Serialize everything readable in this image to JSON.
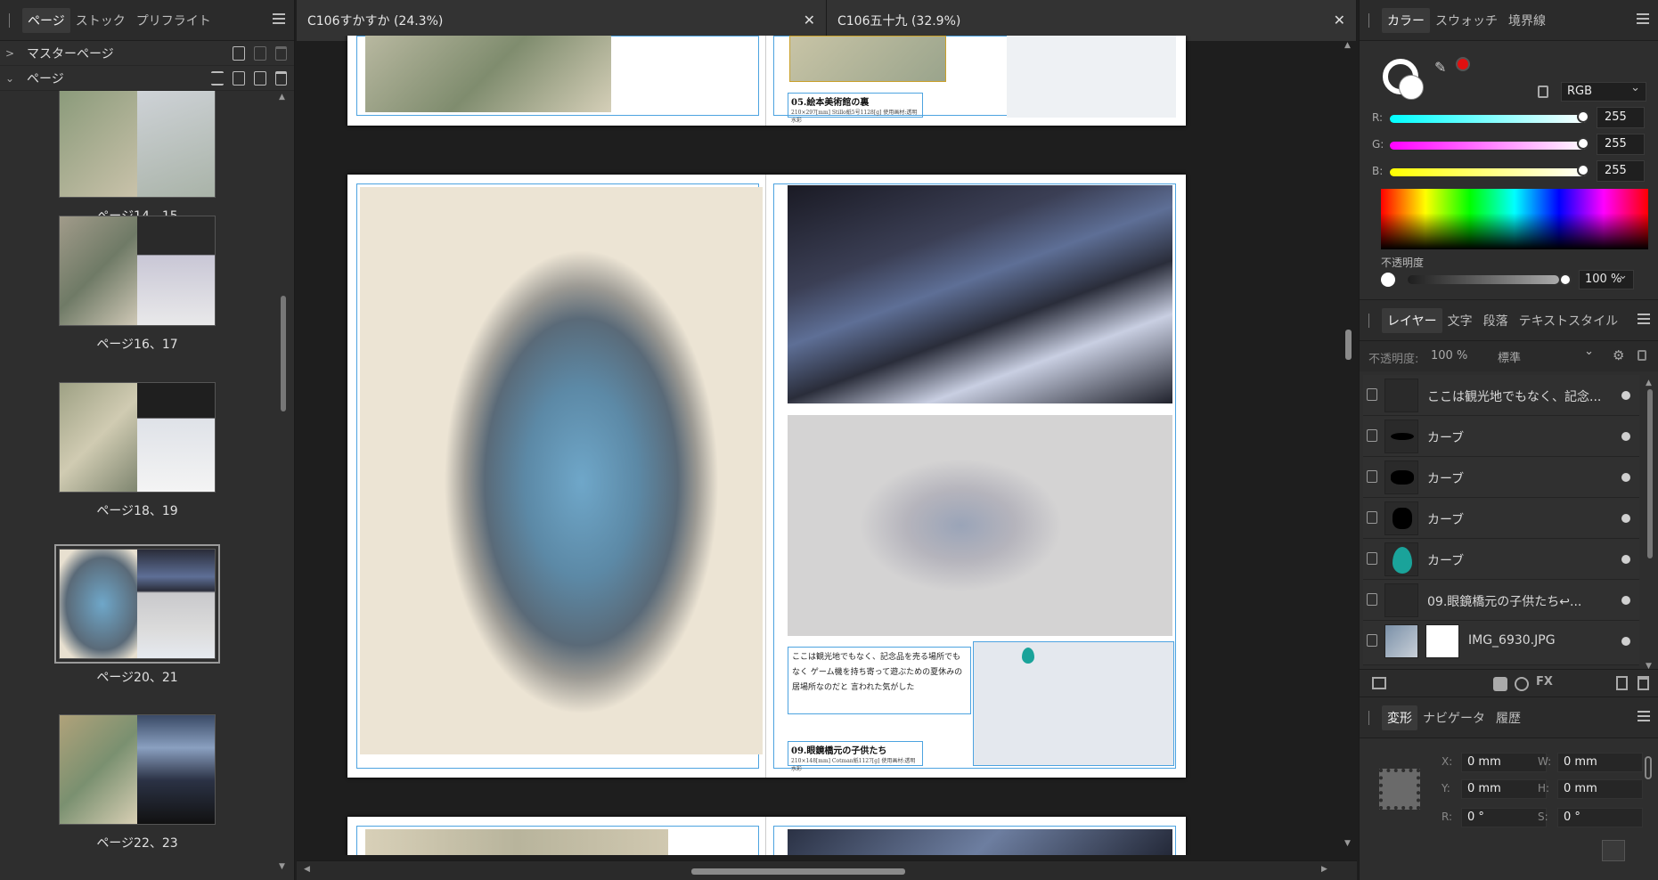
{
  "left_panel": {
    "tabs": [
      "ページ",
      "ストック",
      "プリフライト"
    ],
    "master_pages_label": "マスターページ",
    "pages_label": "ページ",
    "thumbnails": [
      {
        "caption": "ページ14、15"
      },
      {
        "caption": "ページ16、17"
      },
      {
        "caption": "ページ18、19"
      },
      {
        "caption": "ページ20、21"
      },
      {
        "caption": "ページ22、23"
      }
    ]
  },
  "document": {
    "tabs": [
      {
        "title": "C106すかすか (24.3%)"
      },
      {
        "title": "C106五十九 (32.9%)"
      }
    ],
    "top_caption": "05.絵本美術館の裏",
    "top_caption_sub": "210×297[mm] Stillo紙5号1128[g] 使用画材:透明水彩",
    "textbox": "ここは観光地でもなく、記念品を売る場所でもなく ゲーム機を持ち寄って遊ぶための夏休みの居場所なのだと 言われた気がした",
    "caption": "09.眼鏡橋元の子供たち",
    "caption_sub": "210×148[mm] Cotman紙1127[g] 使用画材:透明水彩"
  },
  "right_panel": {
    "color_tabs": [
      "カラー",
      "スウォッチ",
      "境界線"
    ],
    "color_mode": "RGB",
    "r_label": "R:",
    "r_value": "255",
    "g_label": "G:",
    "g_value": "255",
    "b_label": "B:",
    "b_value": "255",
    "opacity_label": "不透明度",
    "opacity_value": "100 %",
    "layer_tabs": [
      "レイヤー",
      "文字",
      "段落",
      "テキストスタイル"
    ],
    "layer_opacity_label": "不透明度:",
    "layer_opacity_value": "100 %",
    "blend_mode": "標準",
    "layers": [
      {
        "name": "ここは観光地でもなく、記念..."
      },
      {
        "name": "カーブ"
      },
      {
        "name": "カーブ"
      },
      {
        "name": "カーブ"
      },
      {
        "name": "カーブ"
      },
      {
        "name": "09.眼鏡橋元の子供たち↩..."
      },
      {
        "name": "IMG_6930.JPG"
      }
    ],
    "transform_tabs": [
      "変形",
      "ナビゲータ",
      "履歴"
    ],
    "x_label": "X:",
    "x_value": "0 mm",
    "y_label": "Y:",
    "y_value": "0 mm",
    "w_label": "W:",
    "w_value": "0 mm",
    "h_label": "H:",
    "h_value": "0 mm",
    "r_rot_label": "R:",
    "r_rot_value": "0 °",
    "s_label": "S:",
    "s_value": "0 °"
  },
  "colors": {
    "accent_margin": "#4da3e0",
    "pin_teal": "#1aa39a",
    "red_swatch": "#e01010"
  }
}
